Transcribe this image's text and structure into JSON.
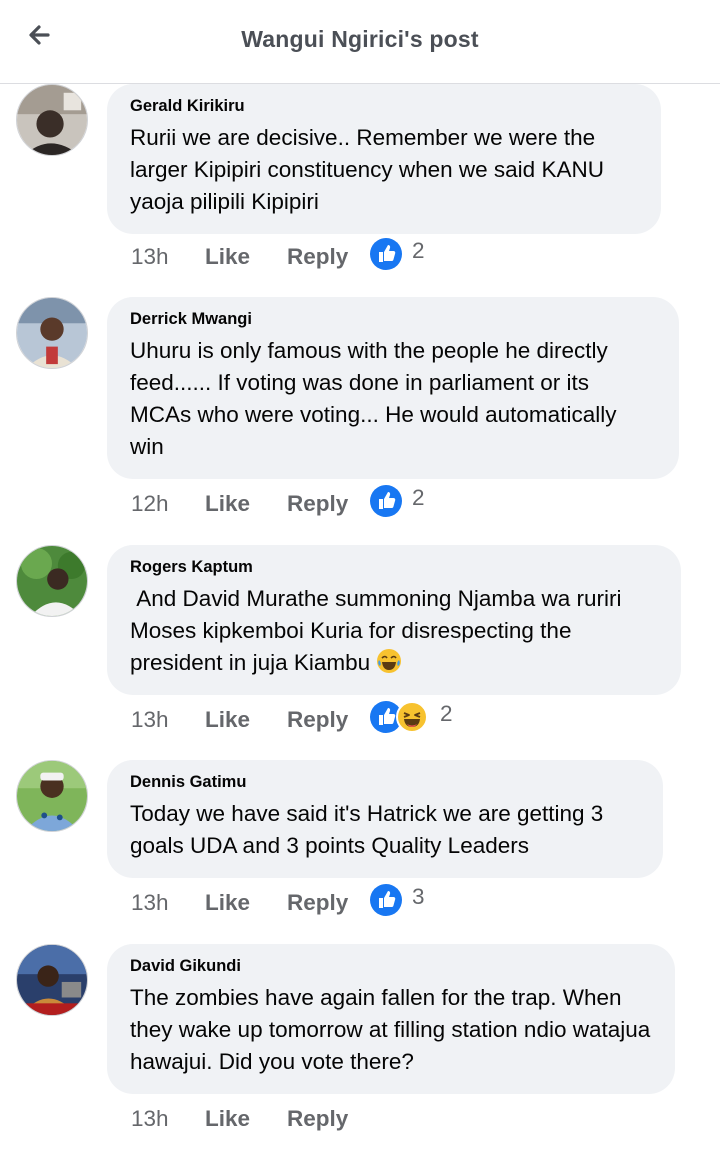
{
  "header": {
    "title": "Wangui Ngirici's post",
    "back_icon": "arrow-left-icon"
  },
  "comments": [
    {
      "author": "Gerald Kirikiru",
      "text": "Rurii we are decisive.. Remember we were the larger Kipipiri constituency when we said KANU yaoja pilipili Kipipiri",
      "time": "13h",
      "like": "Like",
      "reply": "Reply",
      "reaction_count": "2",
      "reactions": [
        "like"
      ]
    },
    {
      "author": "Derrick Mwangi",
      "text": "Uhuru is only famous with the people he directly feed...... If voting was done in parliament or its MCAs who were voting... He would automatically win",
      "time": "12h",
      "like": "Like",
      "reply": "Reply",
      "reaction_count": "2",
      "reactions": [
        "like"
      ]
    },
    {
      "author": "Rogers Kaptum",
      "text": " And David Murathe summoning Njamba wa ruriri Moses kipkemboi Kuria for disrespecting the president in juja Kiambu",
      "time": "13h",
      "like": "Like",
      "reply": "Reply",
      "reaction_count": "2",
      "reactions": [
        "like",
        "haha"
      ]
    },
    {
      "author": "Dennis Gatimu",
      "text": "Today we have said it's Hatrick we are getting 3 goals UDA and 3 points Quality Leaders",
      "time": "13h",
      "like": "Like",
      "reply": "Reply",
      "reaction_count": "3",
      "reactions": [
        "like"
      ]
    },
    {
      "author": "David Gikundi",
      "text": "The zombies have again fallen for the trap. When they wake up tomorrow at filling station ndio watajua hawajui. Did you vote there?",
      "time": "13h",
      "like": "Like",
      "reply": "Reply"
    }
  ],
  "colors": {
    "like_blue": "#1877f2",
    "bubble_bg": "#f0f2f5",
    "meta_gray": "#65676b"
  }
}
